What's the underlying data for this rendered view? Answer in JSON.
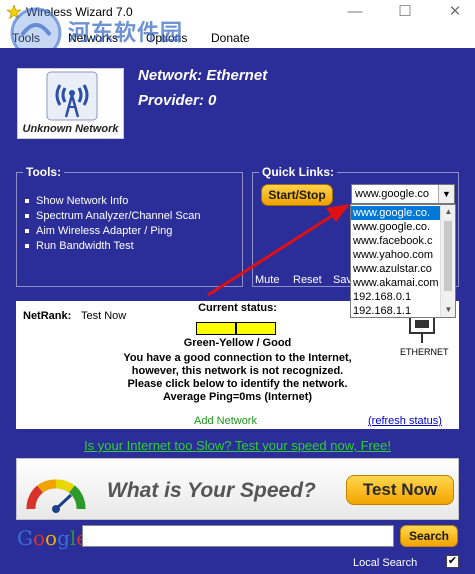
{
  "window": {
    "title": "Wireless Wizard 7.0",
    "min_glyph": "—",
    "max_glyph": "☐",
    "close_glyph": "✕"
  },
  "menu": {
    "items": [
      "Tools",
      "Networks",
      "Options",
      "Donate"
    ]
  },
  "watermark": {
    "text": "河东软件园",
    "url": "www.pc0359.cn"
  },
  "logo": {
    "caption": "Unknown Network"
  },
  "network": {
    "label": "Network: Ethernet",
    "provider": "Provider: 0"
  },
  "tools": {
    "title": "Tools:",
    "items": [
      "Show Network Info",
      "Spectrum Analyzer/Channel Scan",
      "Aim Wireless Adapter / Ping",
      "Run Bandwidth Test"
    ]
  },
  "quicklinks": {
    "title": "Quick Links:",
    "startstop_label": "Start/Stop",
    "selected": "www.google.co",
    "options": [
      "www.google.co.",
      "www.google.co.",
      "www.facebook.c",
      "www.yahoo.com",
      "www.azulstar.co",
      "www.akamai.com",
      "192.168.0.1",
      "192.168.1.1"
    ],
    "mute_label": "Mute",
    "reset_label": "Reset",
    "save_label": "Sav"
  },
  "status": {
    "netrank_label": "NetRank:",
    "testnow_label": "Test Now",
    "current_status_label": "Current status:",
    "result": "Green-Yellow / Good",
    "lines": [
      "You have a good connection to the Internet,",
      "however, this network is not recognized.",
      "Please click below to identify the network.",
      "Average Ping=0ms (Internet)"
    ],
    "add_network_label": "Add Network",
    "refresh_label": "(refresh status)",
    "ethernet_label": "ETHERNET"
  },
  "speed_link": "Is your Internet too Slow?  Test your speed now, Free!",
  "banner": {
    "question": "What is Your Speed?",
    "button_label": "Test Now"
  },
  "search": {
    "logo_letters": [
      "G",
      "o",
      "o",
      "g",
      "l",
      "e"
    ],
    "logo_colors": [
      "#3b6fd6",
      "#d8332a",
      "#e8b000",
      "#3b6fd6",
      "#2b9a2b",
      "#d8332a"
    ],
    "value": "",
    "button_label": "Search",
    "local_search_label": "Local Search",
    "local_search_checked": "✔"
  },
  "colors": {
    "background": "#2b2d98",
    "accent": "#f3a300",
    "link_green": "#2ed12e"
  }
}
